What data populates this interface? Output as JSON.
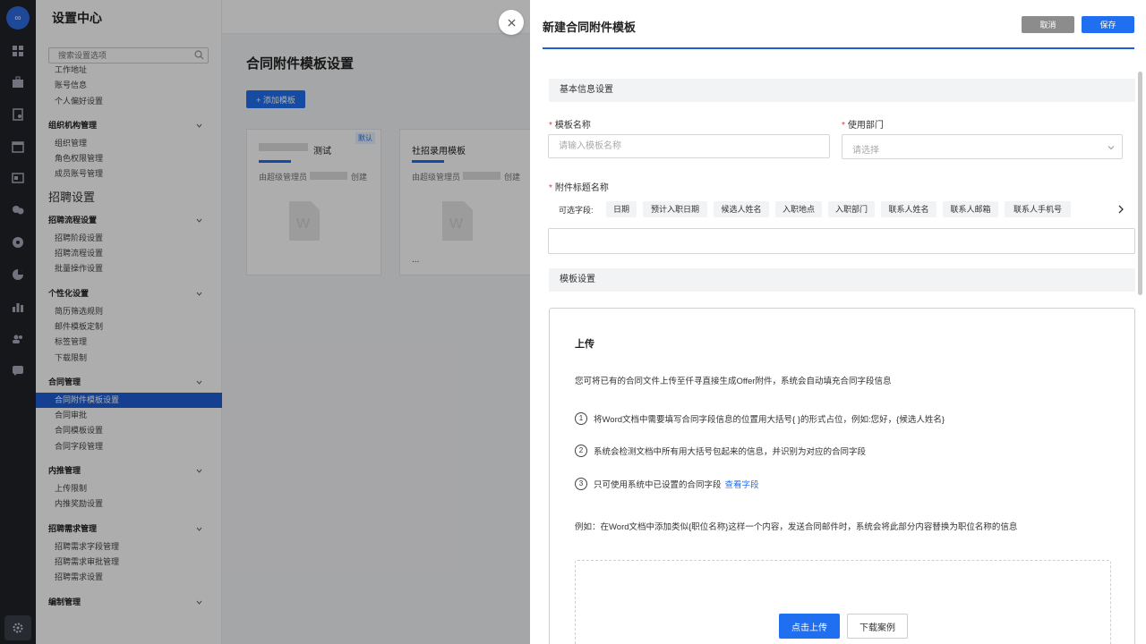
{
  "sidebar": {
    "title": "设置中心",
    "search_placeholder": "搜索设置选项",
    "top_items": [
      "工作地址",
      "账号信息",
      "个人偏好设置"
    ],
    "group_org": "组织机构管理",
    "org_items": [
      "组织管理",
      "角色权限管理",
      "成员账号管理"
    ],
    "section_recruit": "招聘设置",
    "group_flow": "招聘流程设置",
    "flow_items": [
      "招聘阶段设置",
      "招聘流程设置",
      "批量操作设置"
    ],
    "group_personal": "个性化设置",
    "personal_items": [
      "简历筛选规则",
      "邮件模板定制",
      "标签管理",
      "下载限制"
    ],
    "group_contract": "合同管理",
    "contract_items": [
      "合同附件模板设置",
      "合同审批",
      "合同模板设置",
      "合同字段管理"
    ],
    "group_referral": "内推管理",
    "referral_items": [
      "上传限制",
      "内推奖励设置"
    ],
    "group_demand": "招聘需求管理",
    "demand_items": [
      "招聘需求字段管理",
      "招聘需求审批管理",
      "招聘需求设置"
    ],
    "group_staffing": "编制管理"
  },
  "main": {
    "page_title": "合同附件模板设置",
    "add_button": "+ 添加模板",
    "cards": [
      {
        "name": "测试",
        "badge": "默认",
        "creator_prefix": "由超级管理员",
        "creator_suffix": "创建"
      },
      {
        "name": "社招录用模板",
        "creator_prefix": "由超级管理员",
        "creator_suffix": "创建",
        "more": "..."
      }
    ]
  },
  "drawer": {
    "title": "新建合同附件模板",
    "cancel": "取消",
    "save": "保存",
    "section_basic": "基本信息设置",
    "label_name": "模板名称",
    "name_placeholder": "请输入模板名称",
    "label_dept": "使用部门",
    "dept_placeholder": "请选择",
    "label_attach_title": "附件标题名称",
    "chips_label": "可选字段:",
    "chips": [
      "日期",
      "预计入职日期",
      "候选人姓名",
      "入职地点",
      "入职部门",
      "联系人姓名",
      "联系人邮箱",
      "联系人手机号"
    ],
    "attach_title_value": "",
    "section_template": "模板设置",
    "upload": {
      "title": "上传",
      "desc": "您可将已有的合同文件上传至仟寻直接生成Offer附件，系统会自动填充合同字段信息",
      "step1": "将Word文档中需要填写合同字段信息的位置用大括号{ }的形式占位，例如:您好，{候选人姓名}",
      "step2": "系统会检测文档中所有用大括号包起来的信息，并识别为对应的合同字段",
      "step3": "只可使用系统中已设置的合同字段",
      "step3_link": "查看字段",
      "step_nums": [
        "1",
        "2",
        "3"
      ],
      "example": "例如：在Word文档中添加类似{职位名称}这样一个内容，发送合同邮件时，系统会将此部分内容替换为职位名称的信息",
      "btn_upload": "点击上传",
      "btn_download": "下载案例"
    }
  },
  "colors": {
    "accent": "#1f6ff0",
    "active_menu": "#1f5fd6",
    "rail": "#1f2329",
    "required": "#ee3333"
  }
}
